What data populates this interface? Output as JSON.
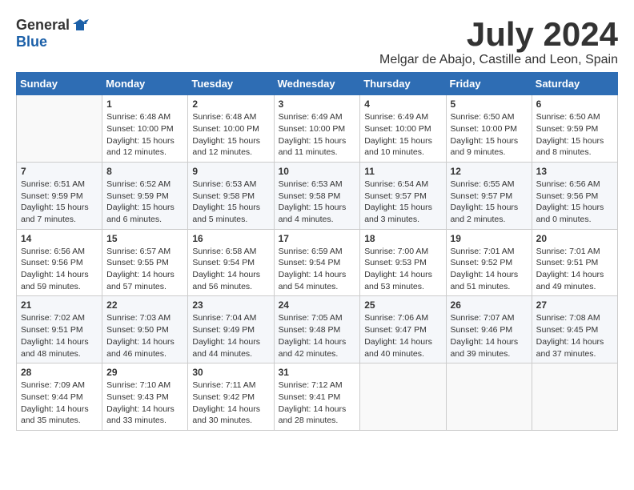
{
  "logo": {
    "general": "General",
    "blue": "Blue"
  },
  "title": "July 2024",
  "location": "Melgar de Abajo, Castille and Leon, Spain",
  "headers": [
    "Sunday",
    "Monday",
    "Tuesday",
    "Wednesday",
    "Thursday",
    "Friday",
    "Saturday"
  ],
  "weeks": [
    [
      {
        "day": "",
        "info": ""
      },
      {
        "day": "1",
        "info": "Sunrise: 6:48 AM\nSunset: 10:00 PM\nDaylight: 15 hours\nand 12 minutes."
      },
      {
        "day": "2",
        "info": "Sunrise: 6:48 AM\nSunset: 10:00 PM\nDaylight: 15 hours\nand 12 minutes."
      },
      {
        "day": "3",
        "info": "Sunrise: 6:49 AM\nSunset: 10:00 PM\nDaylight: 15 hours\nand 11 minutes."
      },
      {
        "day": "4",
        "info": "Sunrise: 6:49 AM\nSunset: 10:00 PM\nDaylight: 15 hours\nand 10 minutes."
      },
      {
        "day": "5",
        "info": "Sunrise: 6:50 AM\nSunset: 10:00 PM\nDaylight: 15 hours\nand 9 minutes."
      },
      {
        "day": "6",
        "info": "Sunrise: 6:50 AM\nSunset: 9:59 PM\nDaylight: 15 hours\nand 8 minutes."
      }
    ],
    [
      {
        "day": "7",
        "info": "Sunrise: 6:51 AM\nSunset: 9:59 PM\nDaylight: 15 hours\nand 7 minutes."
      },
      {
        "day": "8",
        "info": "Sunrise: 6:52 AM\nSunset: 9:59 PM\nDaylight: 15 hours\nand 6 minutes."
      },
      {
        "day": "9",
        "info": "Sunrise: 6:53 AM\nSunset: 9:58 PM\nDaylight: 15 hours\nand 5 minutes."
      },
      {
        "day": "10",
        "info": "Sunrise: 6:53 AM\nSunset: 9:58 PM\nDaylight: 15 hours\nand 4 minutes."
      },
      {
        "day": "11",
        "info": "Sunrise: 6:54 AM\nSunset: 9:57 PM\nDaylight: 15 hours\nand 3 minutes."
      },
      {
        "day": "12",
        "info": "Sunrise: 6:55 AM\nSunset: 9:57 PM\nDaylight: 15 hours\nand 2 minutes."
      },
      {
        "day": "13",
        "info": "Sunrise: 6:56 AM\nSunset: 9:56 PM\nDaylight: 15 hours\nand 0 minutes."
      }
    ],
    [
      {
        "day": "14",
        "info": "Sunrise: 6:56 AM\nSunset: 9:56 PM\nDaylight: 14 hours\nand 59 minutes."
      },
      {
        "day": "15",
        "info": "Sunrise: 6:57 AM\nSunset: 9:55 PM\nDaylight: 14 hours\nand 57 minutes."
      },
      {
        "day": "16",
        "info": "Sunrise: 6:58 AM\nSunset: 9:54 PM\nDaylight: 14 hours\nand 56 minutes."
      },
      {
        "day": "17",
        "info": "Sunrise: 6:59 AM\nSunset: 9:54 PM\nDaylight: 14 hours\nand 54 minutes."
      },
      {
        "day": "18",
        "info": "Sunrise: 7:00 AM\nSunset: 9:53 PM\nDaylight: 14 hours\nand 53 minutes."
      },
      {
        "day": "19",
        "info": "Sunrise: 7:01 AM\nSunset: 9:52 PM\nDaylight: 14 hours\nand 51 minutes."
      },
      {
        "day": "20",
        "info": "Sunrise: 7:01 AM\nSunset: 9:51 PM\nDaylight: 14 hours\nand 49 minutes."
      }
    ],
    [
      {
        "day": "21",
        "info": "Sunrise: 7:02 AM\nSunset: 9:51 PM\nDaylight: 14 hours\nand 48 minutes."
      },
      {
        "day": "22",
        "info": "Sunrise: 7:03 AM\nSunset: 9:50 PM\nDaylight: 14 hours\nand 46 minutes."
      },
      {
        "day": "23",
        "info": "Sunrise: 7:04 AM\nSunset: 9:49 PM\nDaylight: 14 hours\nand 44 minutes."
      },
      {
        "day": "24",
        "info": "Sunrise: 7:05 AM\nSunset: 9:48 PM\nDaylight: 14 hours\nand 42 minutes."
      },
      {
        "day": "25",
        "info": "Sunrise: 7:06 AM\nSunset: 9:47 PM\nDaylight: 14 hours\nand 40 minutes."
      },
      {
        "day": "26",
        "info": "Sunrise: 7:07 AM\nSunset: 9:46 PM\nDaylight: 14 hours\nand 39 minutes."
      },
      {
        "day": "27",
        "info": "Sunrise: 7:08 AM\nSunset: 9:45 PM\nDaylight: 14 hours\nand 37 minutes."
      }
    ],
    [
      {
        "day": "28",
        "info": "Sunrise: 7:09 AM\nSunset: 9:44 PM\nDaylight: 14 hours\nand 35 minutes."
      },
      {
        "day": "29",
        "info": "Sunrise: 7:10 AM\nSunset: 9:43 PM\nDaylight: 14 hours\nand 33 minutes."
      },
      {
        "day": "30",
        "info": "Sunrise: 7:11 AM\nSunset: 9:42 PM\nDaylight: 14 hours\nand 30 minutes."
      },
      {
        "day": "31",
        "info": "Sunrise: 7:12 AM\nSunset: 9:41 PM\nDaylight: 14 hours\nand 28 minutes."
      },
      {
        "day": "",
        "info": ""
      },
      {
        "day": "",
        "info": ""
      },
      {
        "day": "",
        "info": ""
      }
    ]
  ]
}
